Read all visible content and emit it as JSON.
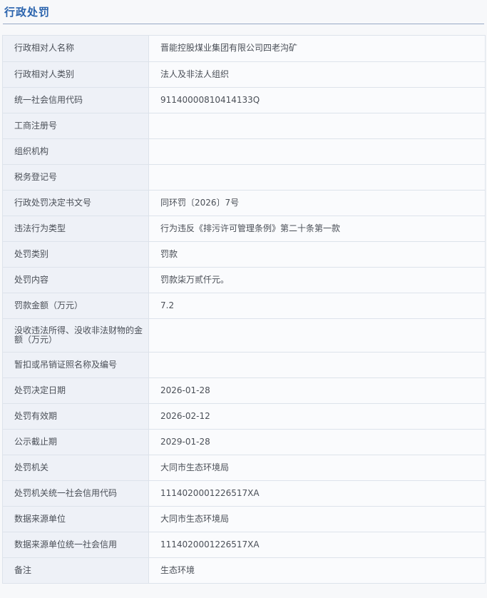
{
  "section": {
    "title": "行政处罚"
  },
  "rows": [
    {
      "label": "行政相对人名称",
      "value": "晋能控股煤业集团有限公司四老沟矿"
    },
    {
      "label": "行政相对人类别",
      "value": "法人及非法人组织"
    },
    {
      "label": "统一社会信用代码",
      "value": "91140000810414133Q"
    },
    {
      "label": "工商注册号",
      "value": ""
    },
    {
      "label": "组织机构",
      "value": ""
    },
    {
      "label": "税务登记号",
      "value": ""
    },
    {
      "label": "行政处罚决定书文号",
      "value": "同环罚〔2026〕7号"
    },
    {
      "label": "违法行为类型",
      "value": "行为违反《排污许可管理条例》第二十条第一款"
    },
    {
      "label": "处罚类别",
      "value": "罚款"
    },
    {
      "label": "处罚内容",
      "value": "罚款柒万贰仟元。"
    },
    {
      "label": "罚款金额（万元）",
      "value": "7.2"
    },
    {
      "label": "没收违法所得、没收非法财物的金额（万元）",
      "value": ""
    },
    {
      "label": "暂扣或吊销证照名称及编号",
      "value": ""
    },
    {
      "label": "处罚决定日期",
      "value": "2026-01-28"
    },
    {
      "label": "处罚有效期",
      "value": "2026-02-12"
    },
    {
      "label": "公示截止期",
      "value": "2029-01-28"
    },
    {
      "label": "处罚机关",
      "value": "大同市生态环境局"
    },
    {
      "label": "处罚机关统一社会信用代码",
      "value": "1114020001226517XA"
    },
    {
      "label": "数据来源单位",
      "value": "大同市生态环境局"
    },
    {
      "label": "数据来源单位统一社会信用",
      "value": "1114020001226517XA"
    },
    {
      "label": "备注",
      "value": "生态环境"
    }
  ]
}
